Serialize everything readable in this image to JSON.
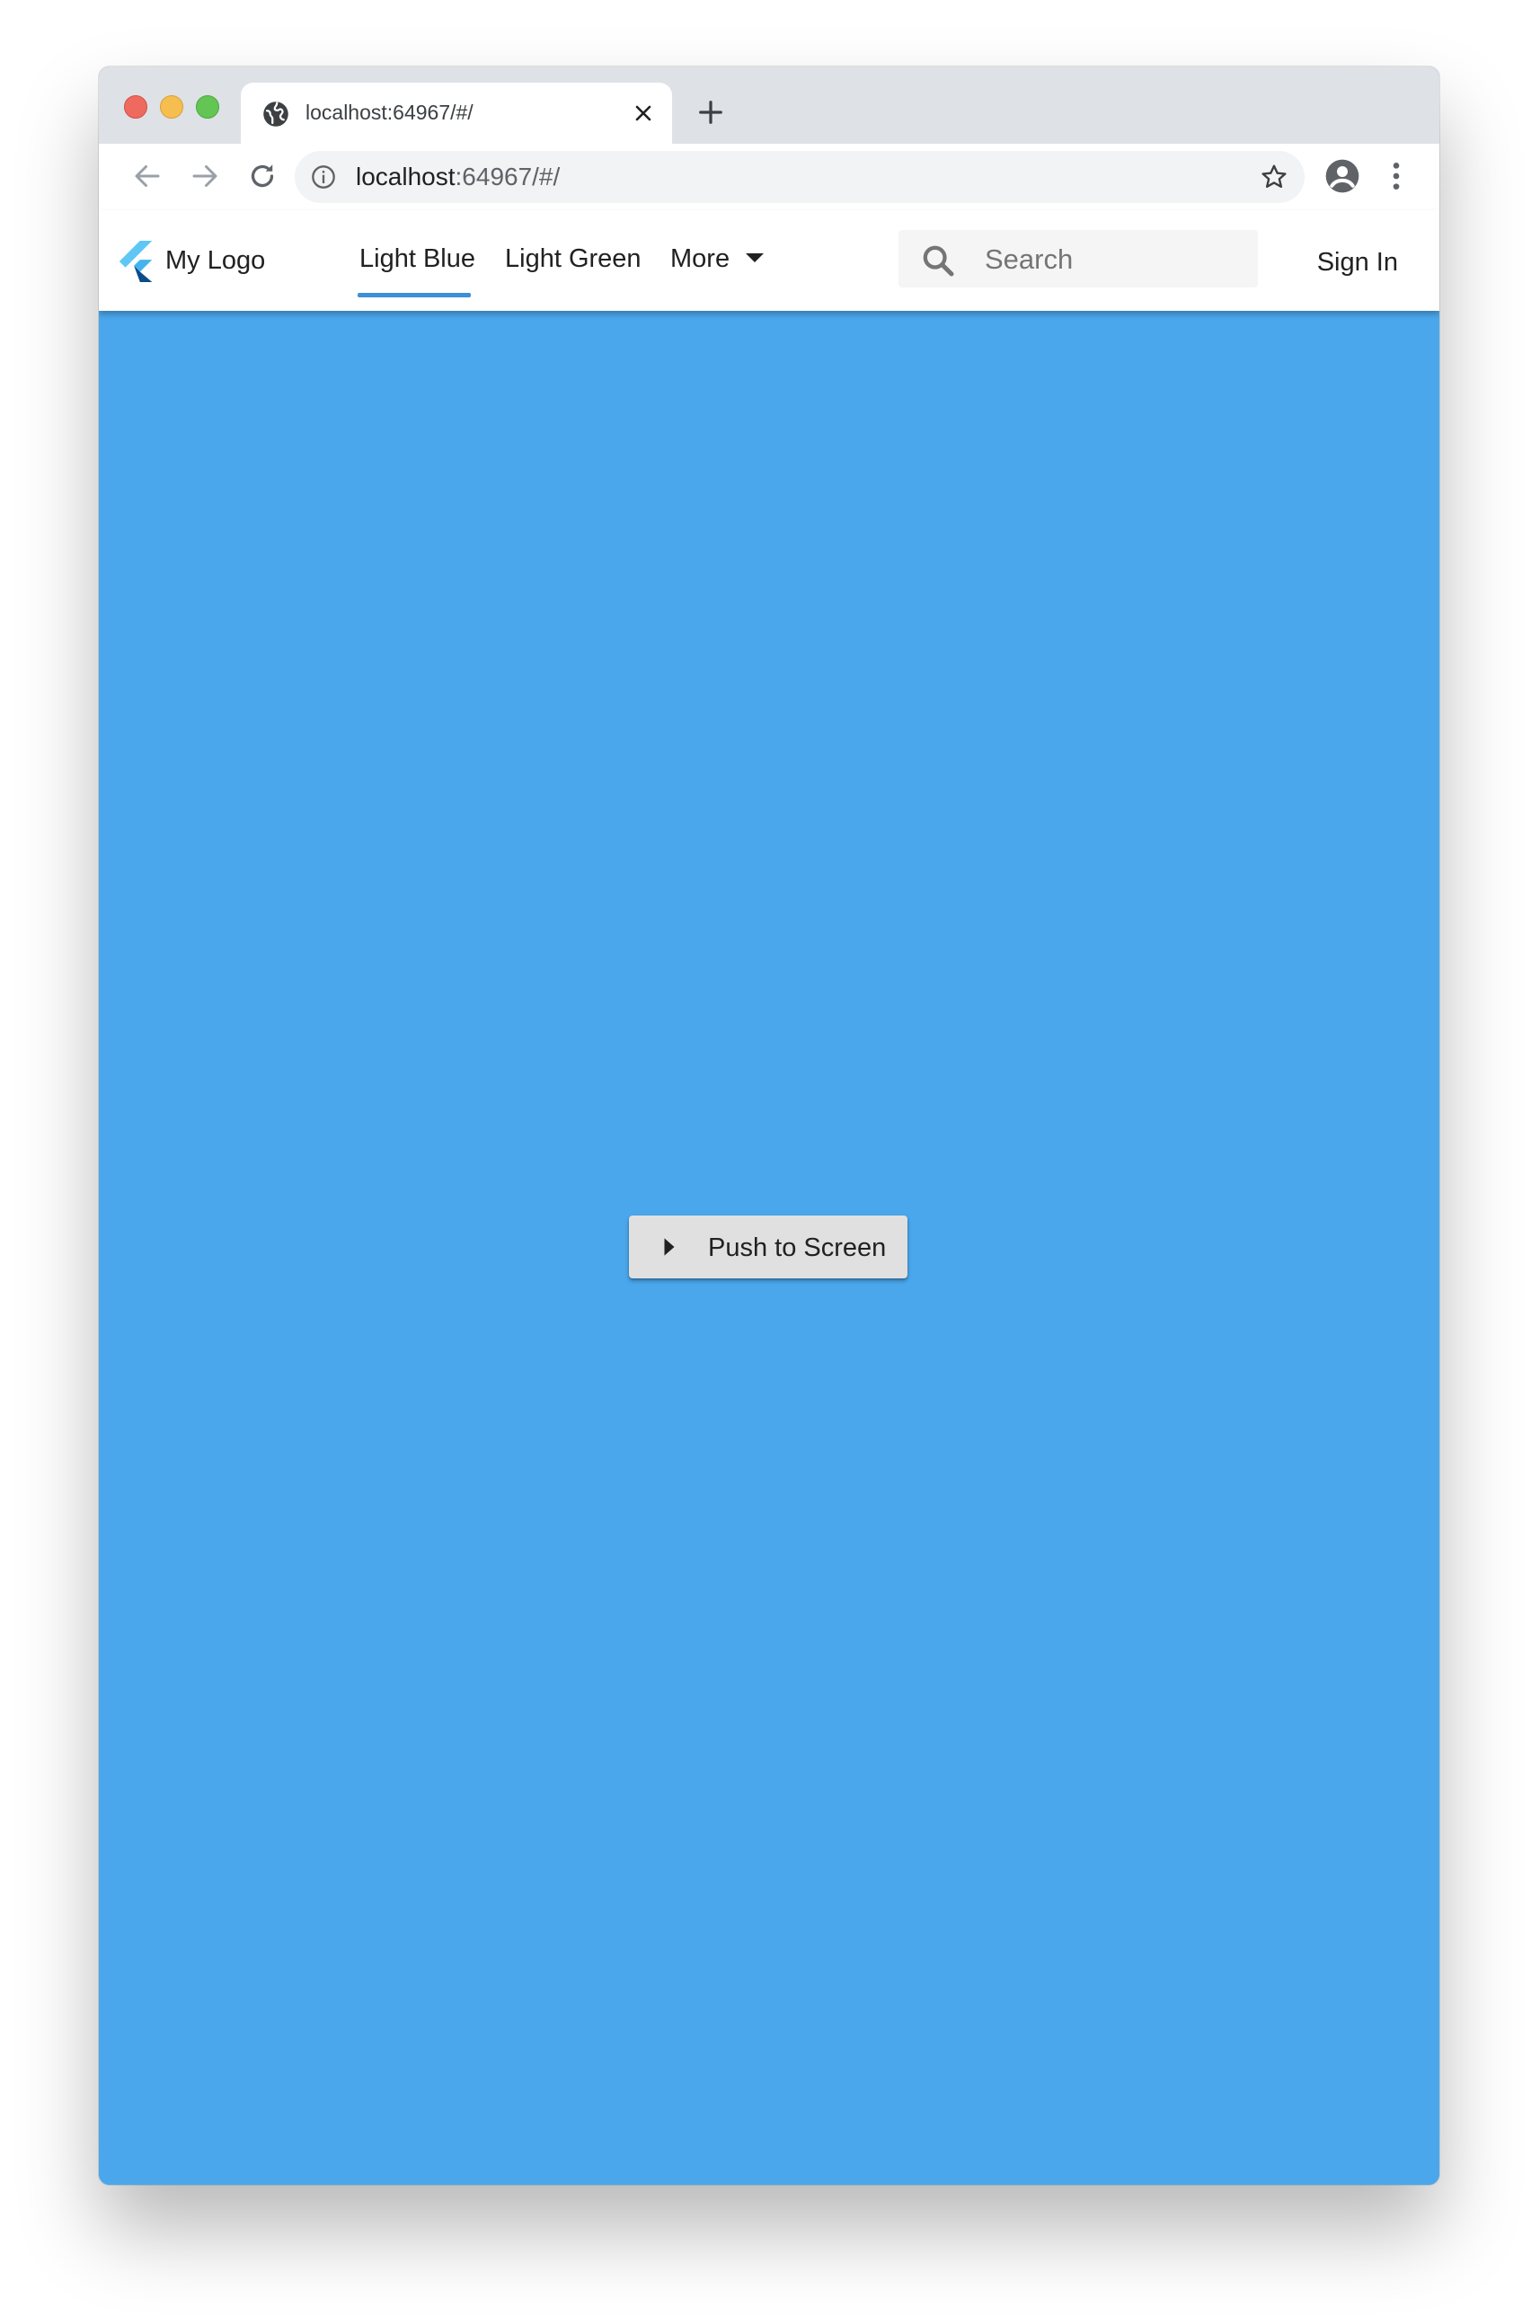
{
  "browser": {
    "tab_title": "localhost:64967/#/",
    "url_host": "localhost",
    "url_path": ":64967/#/"
  },
  "app": {
    "logo_text": "My Logo",
    "nav": [
      {
        "label": "Light Blue",
        "active": true
      },
      {
        "label": "Light Green",
        "active": false
      },
      {
        "label": "More",
        "active": false
      }
    ],
    "search": {
      "placeholder": "Search",
      "value": ""
    },
    "sign_in_label": "Sign In"
  },
  "content": {
    "push_button_label": "Push to Screen"
  },
  "colors": {
    "content_background": "#4aa7ec",
    "active_tab_underline": "#3d8fd8",
    "button_background": "#e0e0e0"
  },
  "icons": [
    "globe-icon",
    "close-icon",
    "plus-icon",
    "back-arrow-icon",
    "forward-arrow-icon",
    "reload-icon",
    "info-icon",
    "star-icon",
    "account-icon",
    "kebab-menu-icon",
    "flutter-logo-icon",
    "caret-down-icon",
    "search-icon",
    "play-arrow-icon"
  ]
}
